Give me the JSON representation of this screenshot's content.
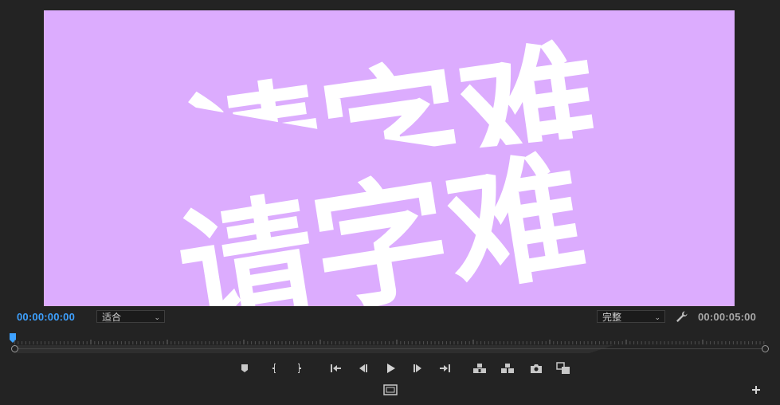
{
  "preview": {
    "background": "#dcacfe",
    "text_color": "#ffffff",
    "title_line1": "请字难",
    "title_line2": "请字难"
  },
  "controls": {
    "current_timecode": "00:00:00:00",
    "duration_timecode": "00:00:05:00",
    "zoom_value": "适合",
    "quality_value": "完整",
    "current_timecode_color": "#3ea1ff"
  },
  "timeline": {
    "playhead_position": 0
  },
  "transport_icons": [
    "add-marker-icon",
    "mark-in-icon",
    "mark-out-icon",
    "go-to-in-icon",
    "step-back-icon",
    "play-icon",
    "step-forward-icon",
    "go-to-out-icon",
    "lift-icon",
    "extract-icon",
    "export-frame-icon",
    "comparison-view-icon"
  ],
  "bottom_icons": [
    "safe-margins-icon",
    "button-editor-plus-icon"
  ]
}
